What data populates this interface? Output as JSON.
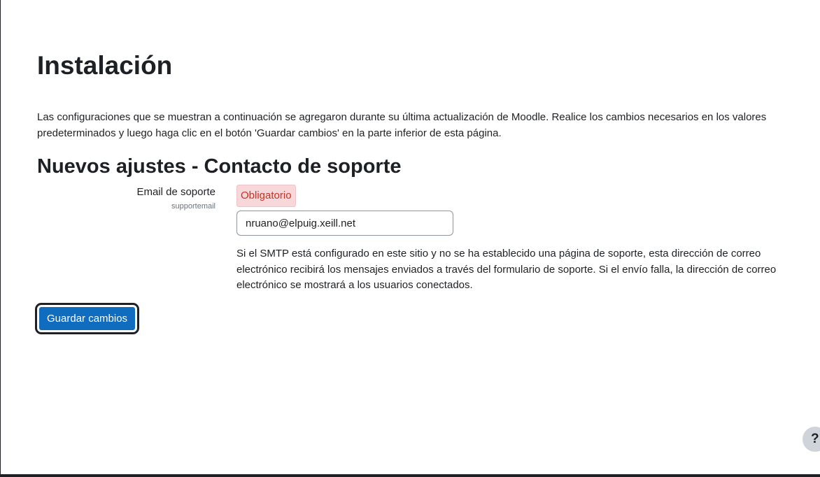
{
  "page": {
    "title": "Instalación",
    "intro": "Las configuraciones que se muestran a continuación se agregaron durante su última actualización de Moodle. Realice los cambios necesarios en los valores predeterminados y luego haga clic en el botón 'Guardar cambios' en la parte inferior de esta página."
  },
  "section": {
    "title": "Nuevos ajustes - Contacto de soporte"
  },
  "setting": {
    "label": "Email de soporte",
    "key": "supportemail",
    "required_badge": "Obligatorio",
    "value": "nruano@elpuig.xeill.net",
    "description": "Si el SMTP está configurado en este sitio y no se ha establecido una página de soporte, esta dirección de correo electrónico recibirá los mensajes enviados a través del formulario de soporte. Si el envío falla, la dirección de correo electrónico se mostrará a los usuarios conectados."
  },
  "actions": {
    "save_label": "Guardar cambios"
  },
  "help": {
    "glyph": "?",
    "icon": "question-mark-icon"
  },
  "colors": {
    "primary": "#0f6cbf",
    "danger_text": "#ca3120",
    "danger_bg": "#f8d7da",
    "text": "#1d2125"
  }
}
